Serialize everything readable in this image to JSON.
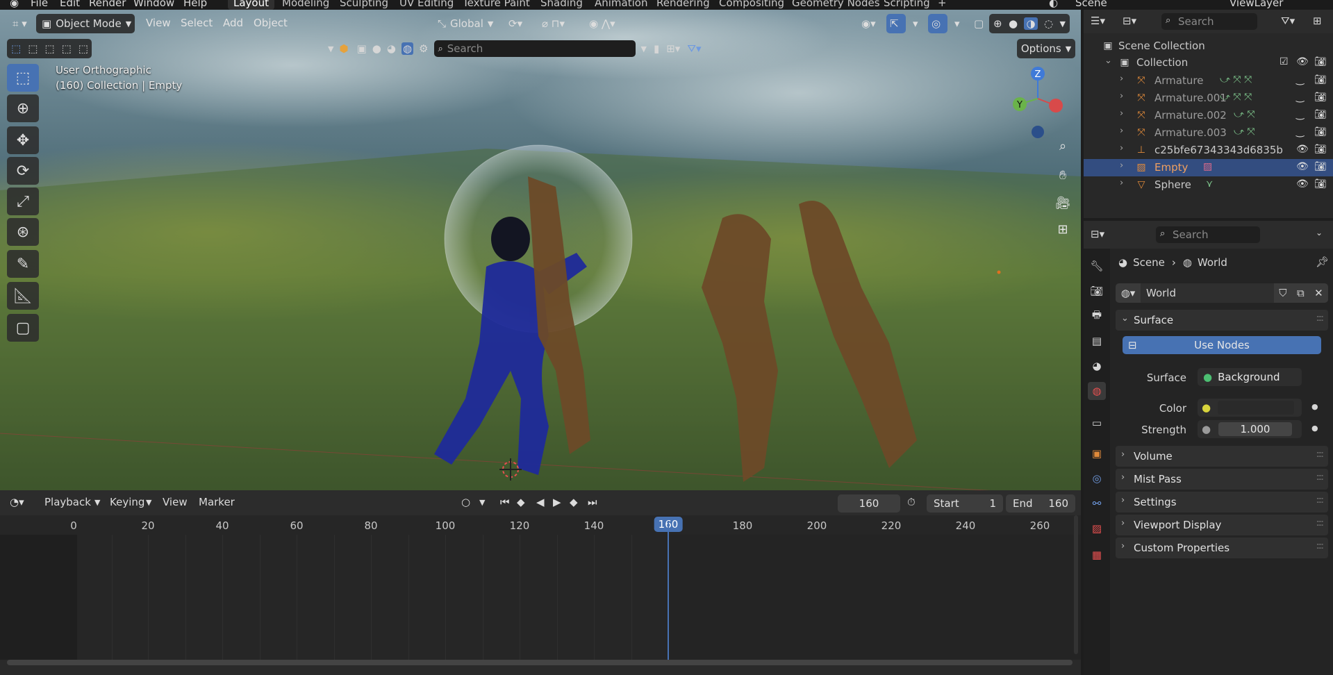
{
  "topbar": {
    "menu": [
      "File",
      "Edit",
      "Render",
      "Window",
      "Help"
    ],
    "workspaces": [
      "Layout",
      "Modeling",
      "Sculpting",
      "UV Editing",
      "Texture Paint",
      "Shading",
      "Animation",
      "Rendering",
      "Compositing",
      "Geometry Nodes",
      "Scripting"
    ],
    "active_workspace": "Layout",
    "scene_label": "Scene",
    "view_layer_label": "ViewLayer"
  },
  "viewport": {
    "mode": "Object Mode",
    "menu": [
      "View",
      "Select",
      "Add",
      "Object"
    ],
    "transform_orientation": "Global",
    "search_placeholder": "Search",
    "options_label": "Options",
    "view_name": "User Orthographic",
    "collection_info": "(160) Collection | Empty",
    "gizmo_axes": [
      "Z",
      "Y"
    ]
  },
  "outliner": {
    "search_placeholder": "Search",
    "root": "Scene Collection",
    "collection": "Collection",
    "items": [
      {
        "name": "Armature",
        "icon": "armature-icon",
        "selected": false
      },
      {
        "name": "Armature.001",
        "icon": "armature-icon",
        "selected": false
      },
      {
        "name": "Armature.002",
        "icon": "armature-icon",
        "selected": false
      },
      {
        "name": "Armature.003",
        "icon": "armature-icon",
        "selected": false
      },
      {
        "name": "c25bfe67343343d6835b",
        "icon": "object-icon",
        "selected": false
      },
      {
        "name": "Empty",
        "icon": "image-empty-icon",
        "selected": true
      },
      {
        "name": "Sphere",
        "icon": "mesh-icon",
        "selected": false
      }
    ]
  },
  "properties": {
    "search_placeholder": "Search",
    "breadcrumb": [
      "Scene",
      "World"
    ],
    "world_name": "World",
    "surface_panel": "Surface",
    "use_nodes_label": "Use Nodes",
    "surface_label": "Surface",
    "surface_value": "Background",
    "color_label": "Color",
    "strength_label": "Strength",
    "strength_value": "1.000",
    "collapsed_panels": [
      "Volume",
      "Mist Pass",
      "Settings",
      "Viewport Display",
      "Custom Properties"
    ],
    "accent": "#4772b3"
  },
  "timeline": {
    "menu": [
      "Playback",
      "Keying",
      "View",
      "Marker"
    ],
    "current_frame": "160",
    "start_label": "Start",
    "start_value": "1",
    "end_label": "End",
    "end_value": "160",
    "ruler": [
      "0",
      "20",
      "40",
      "60",
      "80",
      "100",
      "120",
      "140",
      "160",
      "180",
      "200",
      "220",
      "240",
      "260"
    ],
    "playhead_color": "#4772b3"
  }
}
